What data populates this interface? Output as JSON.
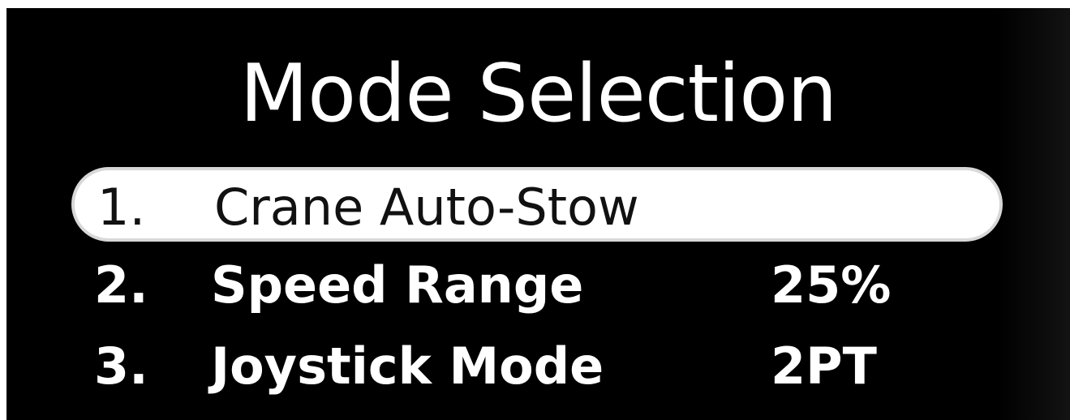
{
  "screen": {
    "title": "Mode Selection",
    "colors": {
      "background": "#000000",
      "text": "#ffffff",
      "highlight_background": "#ffffff",
      "highlight_text": "#111111"
    }
  },
  "menu": {
    "selected_index": 0,
    "items": [
      {
        "number": "1.",
        "label": "Crane Auto-Stow",
        "value": ""
      },
      {
        "number": "2.",
        "label": "Speed Range",
        "value": "25%"
      },
      {
        "number": "3.",
        "label": "Joystick Mode",
        "value": "2PT"
      }
    ]
  }
}
